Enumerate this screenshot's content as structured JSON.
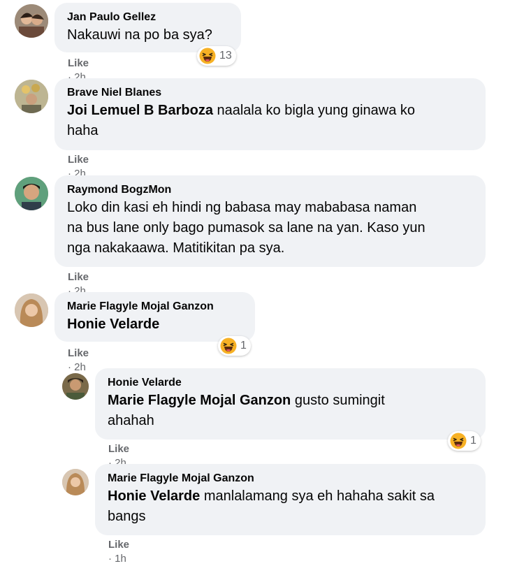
{
  "comments": [
    {
      "author": "Jan Paulo Gellez",
      "tag": "",
      "text": "Nakauwi na po ba sya?",
      "like": "Like",
      "time": "2h",
      "reaction_count": "13"
    },
    {
      "author": "Brave Niel Blanes",
      "tag": "Joi Lemuel B Barboza",
      "text_line1": " naalala ko bigla yung ginawa ko",
      "text_line2": "haha",
      "like": "Like",
      "time": "2h"
    },
    {
      "author": "Raymond BogzMon",
      "text_line1": "Loko din kasi eh hindi ng babasa may mababasa naman",
      "text_line2": "na bus lane only bago pumasok sa lane na yan. Kaso yun",
      "text_line3": "nga nakakaawa. Matitikitan pa sya.",
      "like": "Like",
      "time": "2h"
    },
    {
      "author": "Marie Flagyle Mojal Ganzon",
      "tag": "Honie Velarde",
      "like": "Like",
      "time": "2h",
      "reaction_count": "1"
    }
  ],
  "replies": [
    {
      "author": "Honie Velarde",
      "tag": "Marie Flagyle Mojal Ganzon",
      "text_line1": " gusto sumingit",
      "text_line2": "ahahah",
      "like": "Like",
      "time": "2h",
      "reaction_count": "1"
    },
    {
      "author": "Marie Flagyle Mojal Ganzon",
      "tag": "Honie Velarde",
      "text_line1": " manlalamang sya eh hahaha sakit sa",
      "text_line2": "bangs",
      "like": "Like",
      "time": "1h"
    }
  ],
  "icons": {
    "reaction": "haha-emoji-icon",
    "avatar": "profile-avatar"
  },
  "colors": {
    "bubble": "#f0f2f5",
    "meta": "#65676b",
    "emoji_face": "#f7b125"
  }
}
